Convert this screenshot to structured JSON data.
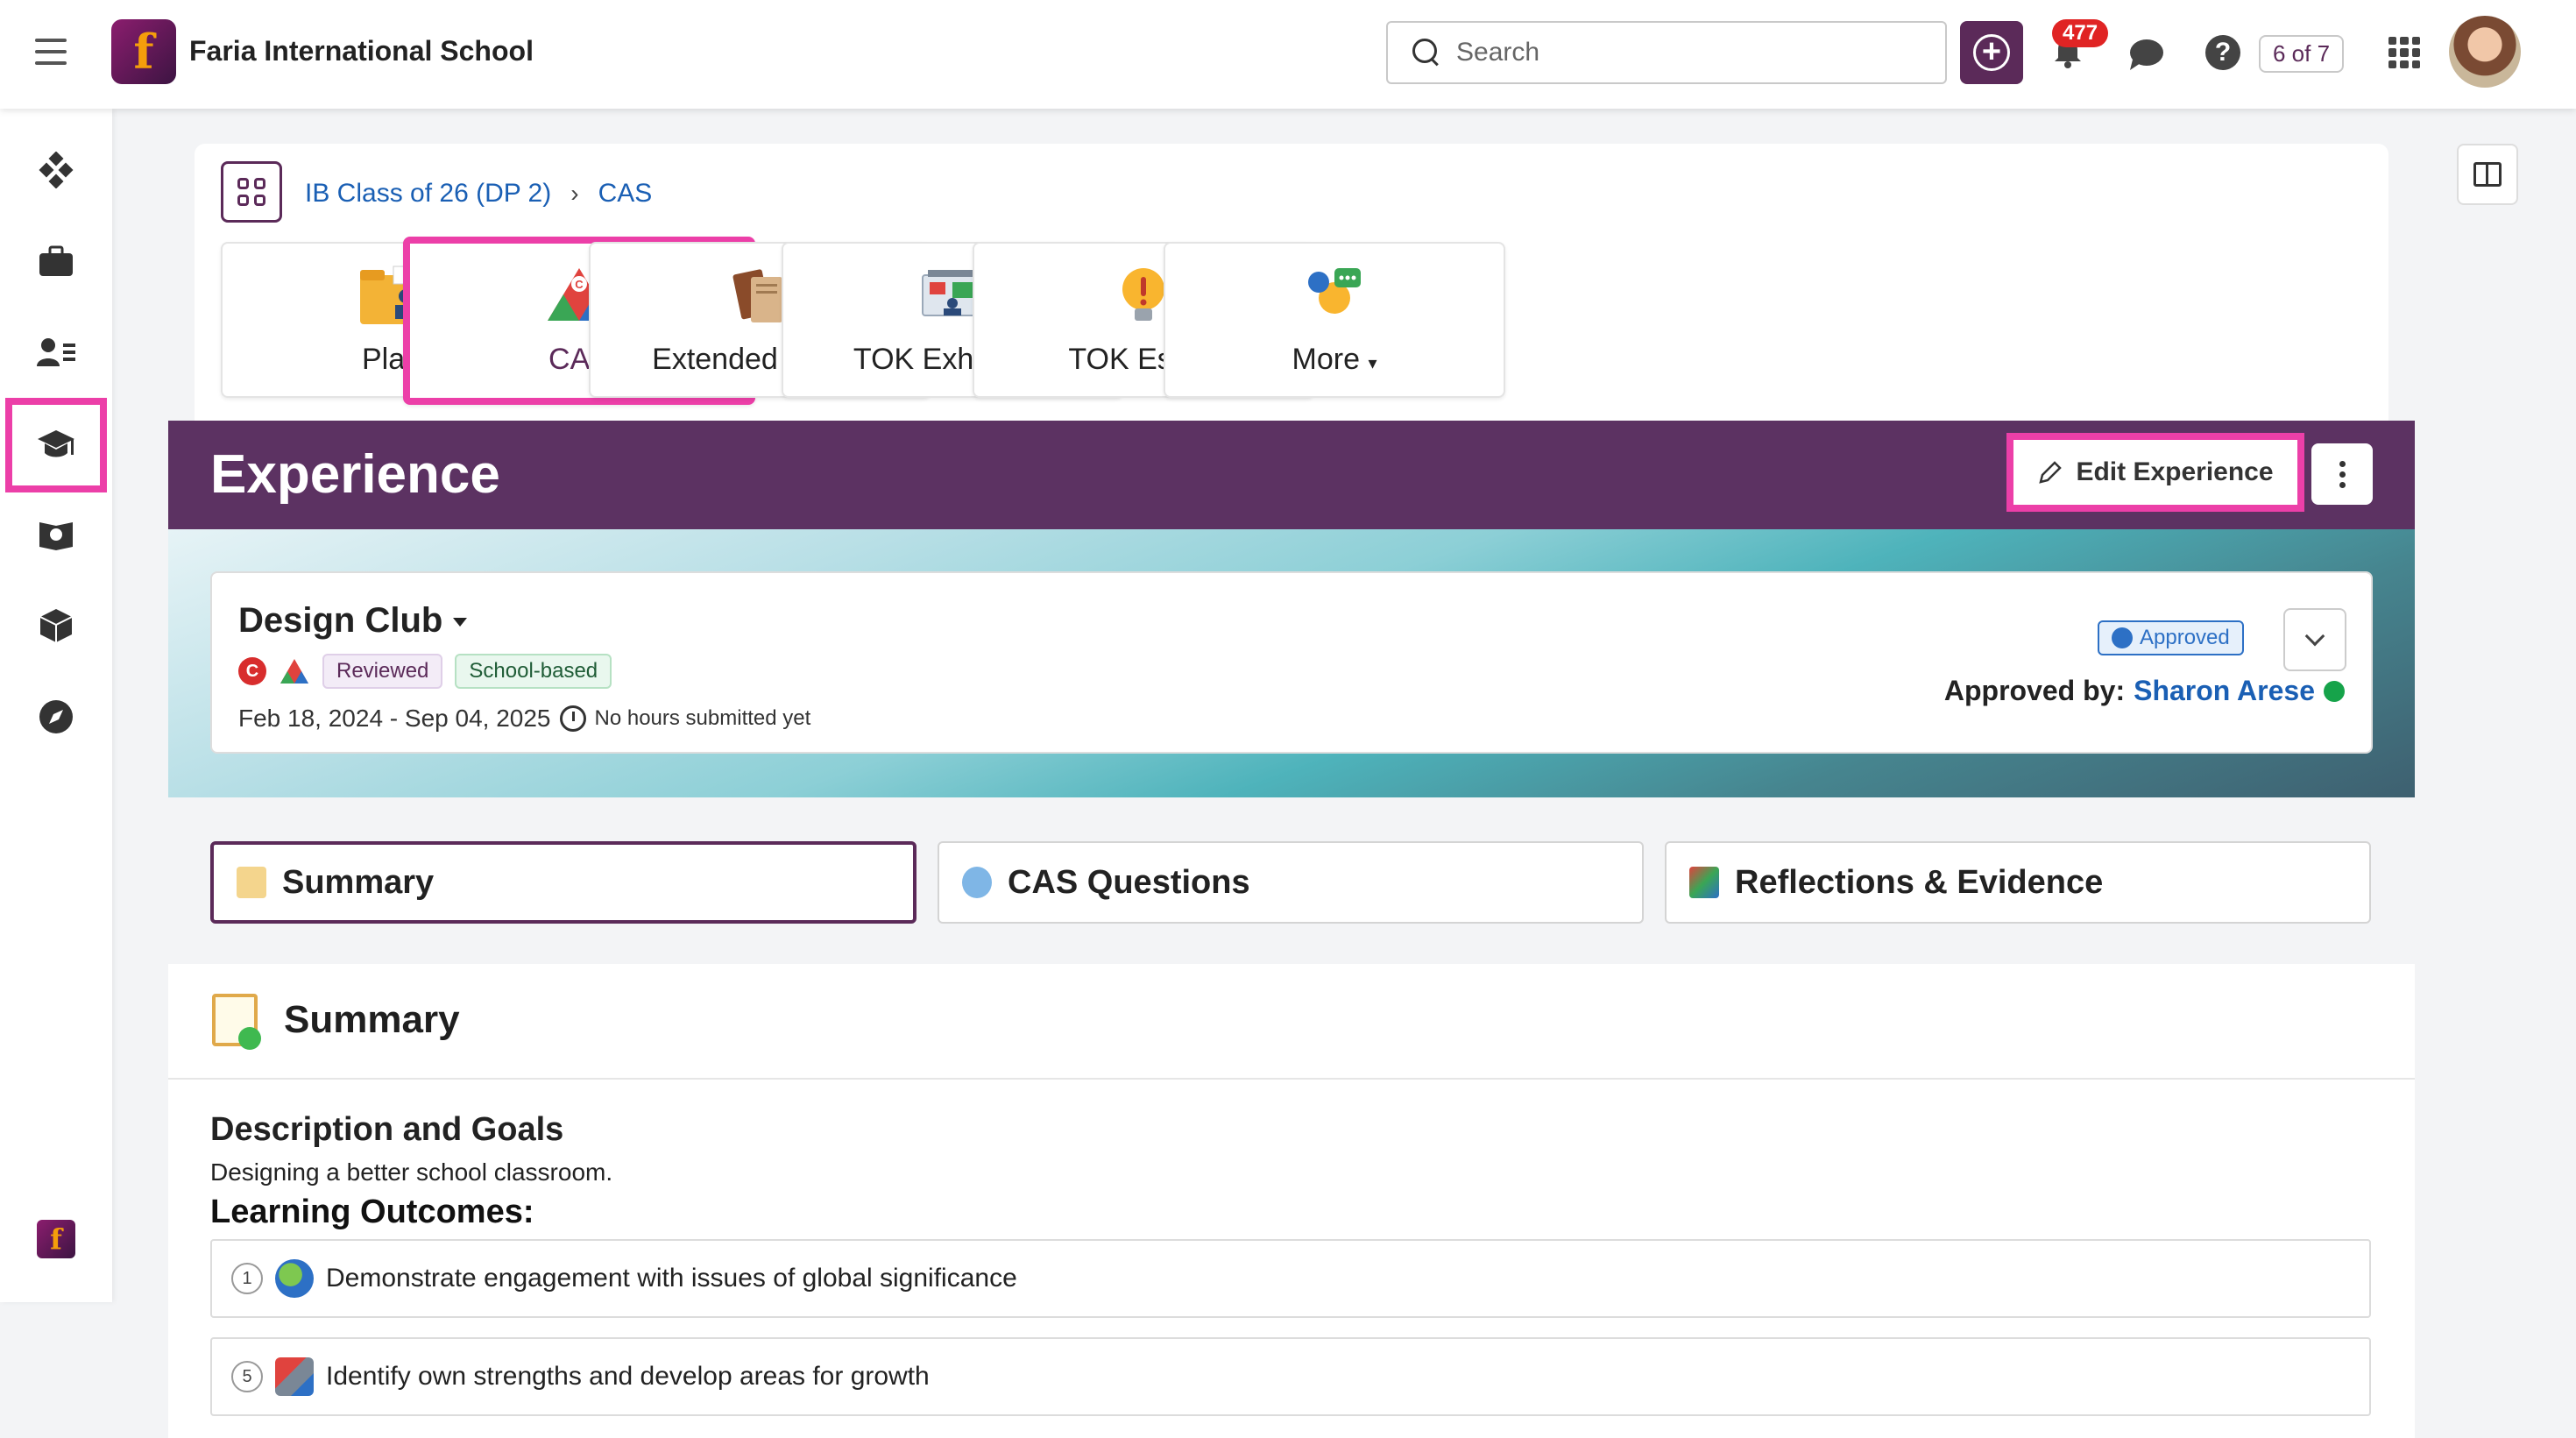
{
  "header": {
    "school_name": "Faria International School",
    "search_placeholder": "Search",
    "notification_count": "477",
    "pager": "6 of 7",
    "help_label": "?"
  },
  "breadcrumb": {
    "class": "IB Class of 26 (DP 2)",
    "current": "CAS"
  },
  "modules": [
    {
      "label": "Plan",
      "icon": "plan-folder-icon"
    },
    {
      "label": "CAS",
      "icon": "cas-triangle-icon"
    },
    {
      "label": "Extended Essay",
      "icon": "books-icon"
    },
    {
      "label": "TOK Exhibition",
      "icon": "exhibition-icon"
    },
    {
      "label": "TOK Essay",
      "icon": "lightbulb-icon"
    },
    {
      "label": "More",
      "icon": "more-icon"
    }
  ],
  "experience": {
    "title": "Experience",
    "edit_label": "Edit Experience",
    "name": "Design Club",
    "badge_c": "C",
    "tags": [
      "Reviewed",
      "School-based"
    ],
    "dates": "Feb 18, 2024 - Sep 04, 2025",
    "hours": "No hours submitted yet",
    "status": "Approved",
    "approved_by_label": "Approved by:",
    "approved_by_name": "Sharon Arese"
  },
  "tabs": [
    "Summary",
    "CAS Questions",
    "Reflections & Evidence"
  ],
  "summary": {
    "heading": "Summary",
    "desc_title": "Description and Goals",
    "desc_text": "Designing a better school classroom.",
    "lo_title": "Learning Outcomes:",
    "outcomes": [
      {
        "num": "1",
        "text": "Demonstrate engagement with issues of global significance"
      },
      {
        "num": "5",
        "text": "Identify own strengths and develop areas for growth"
      }
    ]
  },
  "colors": {
    "brand": "#5b2a59",
    "highlight": "#ec3fa8",
    "link": "#1a5fb4"
  }
}
